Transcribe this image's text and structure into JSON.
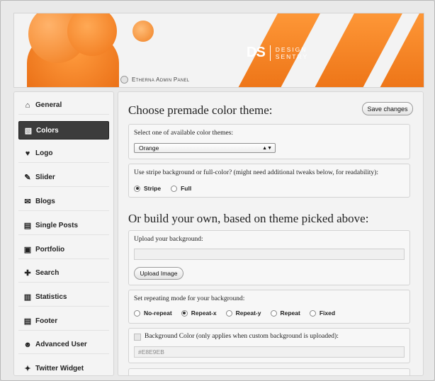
{
  "header": {
    "logo_mark": "DS",
    "logo_text_line1": "DESIGN",
    "logo_text_line2": "SENTRY",
    "admin_panel_label": "Etherna Admin Panel"
  },
  "sidebar": {
    "items": [
      {
        "label": "General",
        "icon": "home-icon",
        "glyph": "⌂"
      },
      {
        "label": "Colors",
        "icon": "image-icon",
        "glyph": "▧"
      },
      {
        "label": "Logo",
        "icon": "heart-icon",
        "glyph": "♥"
      },
      {
        "label": "Slider",
        "icon": "pin-icon",
        "glyph": "✎"
      },
      {
        "label": "Blogs",
        "icon": "comments-icon",
        "glyph": "✉"
      },
      {
        "label": "Single Posts",
        "icon": "document-icon",
        "glyph": "▤"
      },
      {
        "label": "Portfolio",
        "icon": "picture-icon",
        "glyph": "▣"
      },
      {
        "label": "Search",
        "icon": "plus-icon",
        "glyph": "✚"
      },
      {
        "label": "Statistics",
        "icon": "bar-chart-icon",
        "glyph": "▥"
      },
      {
        "label": "Footer",
        "icon": "document-icon",
        "glyph": "▤"
      },
      {
        "label": "Advanced User",
        "icon": "user-icon",
        "glyph": "☻"
      },
      {
        "label": "Twitter Widget",
        "icon": "bird-icon",
        "glyph": "✦"
      }
    ],
    "active_index": 1
  },
  "main": {
    "title": "Choose premade color theme:",
    "save_button": "Save changes",
    "theme_select": {
      "label": "Select one of available color themes:",
      "value": "Orange"
    },
    "stripe_choice": {
      "label": "Use stripe background or full-color? (might need additional tweaks below, for readability):",
      "options": [
        "Stripe",
        "Full"
      ],
      "selected": "Stripe"
    },
    "build_title": "Or build your own, based on theme picked above:",
    "upload": {
      "label": "Upload your background:",
      "value": "",
      "button": "Upload Image"
    },
    "repeat": {
      "label": "Set repeating mode for your background:",
      "options": [
        "No-repeat",
        "Repeat-x",
        "Repeat-y",
        "Repeat",
        "Fixed"
      ],
      "selected": "Repeat-x"
    },
    "bg_color": {
      "label": "Background Color (only applies when custom background is uploaded):",
      "value": "#E8E9EB"
    }
  }
}
